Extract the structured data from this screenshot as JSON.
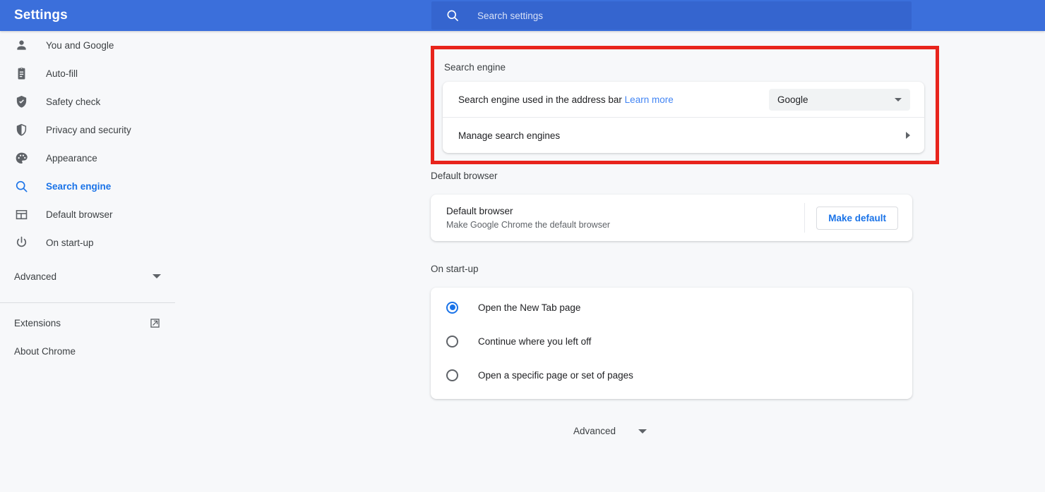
{
  "header": {
    "title": "Settings",
    "search": {
      "placeholder": "Search settings",
      "value": "",
      "icon": "search-icon"
    },
    "background_color": "#3b6fdb"
  },
  "sidebar": {
    "items": [
      {
        "label": "You and Google",
        "icon": "person-icon",
        "active": false
      },
      {
        "label": "Auto-fill",
        "icon": "clipboard-icon",
        "active": false
      },
      {
        "label": "Safety check",
        "icon": "shield-check-icon",
        "active": false
      },
      {
        "label": "Privacy and security",
        "icon": "shield-icon",
        "active": false
      },
      {
        "label": "Appearance",
        "icon": "palette-icon",
        "active": false
      },
      {
        "label": "Search engine",
        "icon": "search-icon",
        "active": true
      },
      {
        "label": "Default browser",
        "icon": "browser-window-icon",
        "active": false
      },
      {
        "label": "On start-up",
        "icon": "power-icon",
        "active": false
      }
    ],
    "advanced": {
      "label": "Advanced",
      "icon": "chevron-down-icon"
    },
    "links": [
      {
        "label": "Extensions",
        "icon": "external-link-icon"
      },
      {
        "label": "About Chrome",
        "icon": ""
      }
    ],
    "active_color": "#1a73e8"
  },
  "main": {
    "search_engine": {
      "title": "Search engine",
      "highlighted": true,
      "highlight_color": "#e8241c",
      "address_bar_row": {
        "label": "Search engine used in the address bar",
        "link": "Learn more",
        "select_value": "Google",
        "select_icon": "chevron-down-icon"
      },
      "manage_row": {
        "label": "Manage search engines",
        "icon": "chevron-right-icon"
      }
    },
    "default_browser": {
      "title": "Default browser",
      "row_title": "Default browser",
      "row_sub": "Make Google Chrome the default browser",
      "button": "Make default"
    },
    "on_startup": {
      "title": "On start-up",
      "options": [
        {
          "label": "Open the New Tab page",
          "selected": true
        },
        {
          "label": "Continue where you left off",
          "selected": false
        },
        {
          "label": "Open a specific page or set of pages",
          "selected": false
        }
      ]
    },
    "advanced_footer": {
      "label": "Advanced",
      "icon": "chevron-down-icon"
    }
  }
}
